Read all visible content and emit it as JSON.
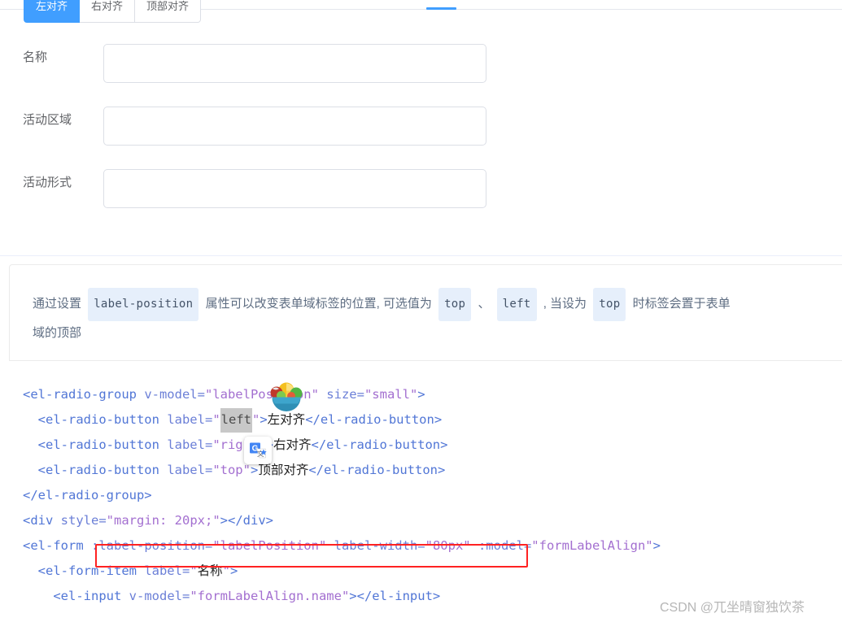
{
  "radio_group": {
    "name": "label-position-radio-group",
    "options": [
      {
        "label": "左对齐",
        "value": "left",
        "active": true
      },
      {
        "label": "右对齐",
        "value": "right",
        "active": false
      },
      {
        "label": "顶部对齐",
        "value": "top",
        "active": false
      }
    ]
  },
  "form": {
    "items": [
      {
        "label": "名称",
        "value": "",
        "placeholder": ""
      },
      {
        "label": "活动区域",
        "value": "",
        "placeholder": ""
      },
      {
        "label": "活动形式",
        "value": "",
        "placeholder": ""
      }
    ]
  },
  "description": {
    "part1": "通过设置",
    "chip1": "label-position",
    "part2": "属性可以改变表单域标签的位置, 可选值为",
    "chip2": "top",
    "part3": "、",
    "chip3": "left",
    "part4": ", 当设为",
    "chip4": "top",
    "part5": "时标签会置于表单",
    "line2": "域的顶部"
  },
  "code": {
    "lines": [
      [
        {
          "t": "<el-radio-group ",
          "c": "tag"
        },
        {
          "t": "v-model=",
          "c": "attr"
        },
        {
          "t": "\"labelPosition\"",
          "c": "str"
        },
        {
          "t": " ",
          "c": "plain"
        },
        {
          "t": "size=",
          "c": "attr"
        },
        {
          "t": "\"small\"",
          "c": "str"
        },
        {
          "t": ">",
          "c": "tag"
        }
      ],
      [
        {
          "t": "  <el-radio-button ",
          "c": "tag"
        },
        {
          "t": "label=",
          "c": "attr"
        },
        {
          "t": "\"",
          "c": "str"
        },
        {
          "t": "left",
          "c": "sel"
        },
        {
          "t": "\"",
          "c": "str"
        },
        {
          "t": ">",
          "c": "tag"
        },
        {
          "t": "左对齐",
          "c": "cn"
        },
        {
          "t": "</el-radio-button>",
          "c": "tag"
        }
      ],
      [
        {
          "t": "  <el-radio-button ",
          "c": "tag"
        },
        {
          "t": "label=",
          "c": "attr"
        },
        {
          "t": "\"right\"",
          "c": "str"
        },
        {
          "t": ">",
          "c": "tag"
        },
        {
          "t": "右对齐",
          "c": "cn"
        },
        {
          "t": "</el-radio-button>",
          "c": "tag"
        }
      ],
      [
        {
          "t": "  <el-radio-button ",
          "c": "tag"
        },
        {
          "t": "label=",
          "c": "attr"
        },
        {
          "t": "\"top\"",
          "c": "str"
        },
        {
          "t": ">",
          "c": "tag"
        },
        {
          "t": "顶部对齐",
          "c": "cn"
        },
        {
          "t": "</el-radio-button>",
          "c": "tag"
        }
      ],
      [
        {
          "t": "</el-radio-group>",
          "c": "tag"
        }
      ],
      [
        {
          "t": "<div ",
          "c": "tag"
        },
        {
          "t": "style=",
          "c": "attr"
        },
        {
          "t": "\"margin: 20px;\"",
          "c": "str"
        },
        {
          "t": "></div>",
          "c": "tag"
        }
      ],
      [
        {
          "t": "<el-form ",
          "c": "tag"
        },
        {
          "t": ":label-position=",
          "c": "attr"
        },
        {
          "t": "\"labelPosition\"",
          "c": "str"
        },
        {
          "t": " ",
          "c": "plain"
        },
        {
          "t": "label-width=",
          "c": "attr"
        },
        {
          "t": "\"80px\"",
          "c": "str"
        },
        {
          "t": " ",
          "c": "plain"
        },
        {
          "t": ":model=",
          "c": "attr"
        },
        {
          "t": "\"formLabelAlign\"",
          "c": "str"
        },
        {
          "t": ">",
          "c": "tag"
        }
      ],
      [
        {
          "t": "  <el-form-item ",
          "c": "tag"
        },
        {
          "t": "label=",
          "c": "attr"
        },
        {
          "t": "\"",
          "c": "str"
        },
        {
          "t": "名称",
          "c": "cn"
        },
        {
          "t": "\"",
          "c": "str"
        },
        {
          "t": ">",
          "c": "tag"
        }
      ],
      [
        {
          "t": "    <el-input ",
          "c": "tag"
        },
        {
          "t": "v-model=",
          "c": "attr"
        },
        {
          "t": "\"formLabelAlign.name\"",
          "c": "str"
        },
        {
          "t": "></el-input>",
          "c": "tag"
        }
      ]
    ]
  },
  "watermark": {
    "text": "CSDN @兀坐晴窗独饮茶"
  },
  "overlays": {
    "emoji": "fruit-bowl-emoji",
    "translate_icon": "google-translate-icon",
    "red_annotation": "red-highlight-rectangle"
  },
  "colors": {
    "accent": "#409eff",
    "red_box": "#ff2222",
    "code_tag": "#5176d6",
    "code_string": "#a36fd0",
    "chip_bg": "#e6effb"
  }
}
